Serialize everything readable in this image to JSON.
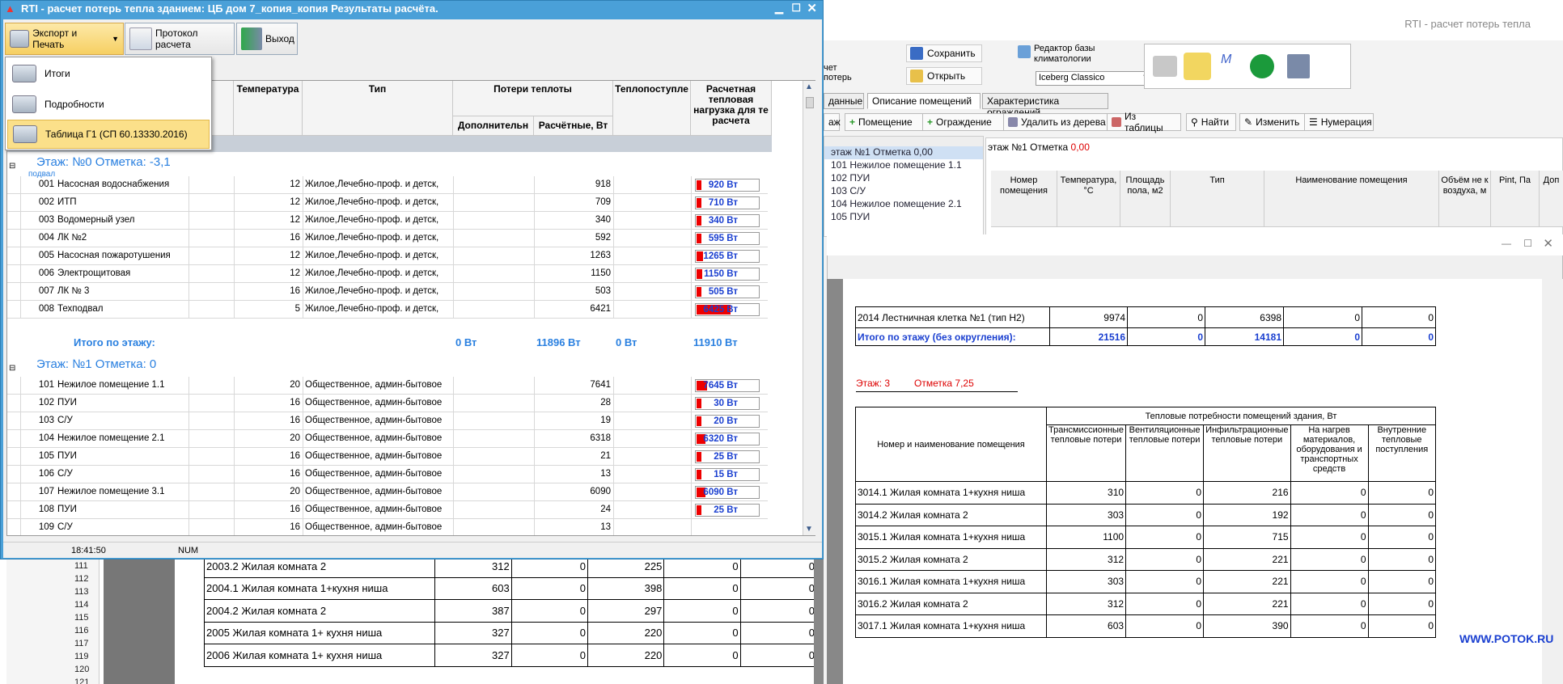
{
  "dialog": {
    "title": "RTI - расчет потерь тепла зданием: ЦБ дом 7_копия_копия Результаты расчёта.",
    "toolbar": {
      "export": "Экспорт и Печать",
      "protocol": "Протокол расчета",
      "exit": "Выход"
    },
    "menu": [
      {
        "label": "Итоги"
      },
      {
        "label": "Подробности"
      },
      {
        "label": "Таблица Г1 (СП 60.13330.2016)"
      }
    ],
    "headers": {
      "temp": "Температура",
      "type": "Тип",
      "losses": "Потери теплоты",
      "additional": "Дополнительн",
      "calculated": "Расчётные, Вт",
      "gains": "Теплопоступле",
      "load": "Расчетная тепловая нагрузка для те расчета"
    },
    "floor0": {
      "title": "Этаж:  №0 Отметка: -3,1",
      "sub": "подвал"
    },
    "floor1": {
      "title": "Этаж:  №1 Отметка: 0"
    },
    "rows0": [
      {
        "n": "001",
        "name": "Насосная водоснабжения",
        "t": "12",
        "type": "Жилое,Лечебно-проф. и детск,",
        "calc": "918",
        "load": "920 Вт",
        "f": 0.08
      },
      {
        "n": "002",
        "name": "ИТП",
        "t": "12",
        "type": "Жилое,Лечебно-проф. и детск,",
        "calc": "709",
        "load": "710 Вт",
        "f": 0.07
      },
      {
        "n": "003",
        "name": "Водомерный узел",
        "t": "12",
        "type": "Жилое,Лечебно-проф. и детск,",
        "calc": "340",
        "load": "340 Вт",
        "f": 0.05
      },
      {
        "n": "004",
        "name": "ЛК №2",
        "t": "16",
        "type": "Жилое,Лечебно-проф. и детск,",
        "calc": "592",
        "load": "595 Вт",
        "f": 0.06
      },
      {
        "n": "005",
        "name": "Насосная пожаротушения",
        "t": "12",
        "type": "Жилое,Лечебно-проф. и детск,",
        "calc": "1263",
        "load": "1265 Вт",
        "f": 0.1
      },
      {
        "n": "006",
        "name": "Электрощитовая",
        "t": "12",
        "type": "Жилое,Лечебно-проф. и детск,",
        "calc": "1150",
        "load": "1150 Вт",
        "f": 0.09
      },
      {
        "n": "007",
        "name": "ЛК № 3",
        "t": "16",
        "type": "Жилое,Лечебно-проф. и детск,",
        "calc": "503",
        "load": "505 Вт",
        "f": 0.06
      },
      {
        "n": "008",
        "name": "Техподвал",
        "t": "5",
        "type": "Жилое,Лечебно-проф. и детск,",
        "calc": "6421",
        "load": "6425 Вт",
        "f": 0.55
      }
    ],
    "total0": {
      "label": "Итого по этажу:",
      "add": "0 Вт",
      "calc": "11896 Вт",
      "gains": "0 Вт",
      "load": "11910 Вт"
    },
    "rows1": [
      {
        "n": "101",
        "name": "Нежилое помещение 1.1",
        "t": "20",
        "type": "Общественное, админ-бытовое",
        "calc": "7641",
        "load": "7645 Вт",
        "f": 0.17
      },
      {
        "n": "102",
        "name": "ПУИ",
        "t": "16",
        "type": "Общественное, админ-бытовое",
        "calc": "28",
        "load": "30 Вт",
        "f": 0
      },
      {
        "n": "103",
        "name": "С/У",
        "t": "16",
        "type": "Общественное, админ-бытовое",
        "calc": "19",
        "load": "20 Вт",
        "f": 0
      },
      {
        "n": "104",
        "name": "Нежилое помещение 2.1",
        "t": "20",
        "type": "Общественное, админ-бытовое",
        "calc": "6318",
        "load": "6320 Вт",
        "f": 0.14
      },
      {
        "n": "105",
        "name": "ПУИ",
        "t": "16",
        "type": "Общественное, админ-бытовое",
        "calc": "21",
        "load": "25 Вт",
        "f": 0
      },
      {
        "n": "106",
        "name": "С/У",
        "t": "16",
        "type": "Общественное, админ-бытовое",
        "calc": "13",
        "load": "15 Вт",
        "f": 0
      },
      {
        "n": "107",
        "name": "Нежилое помещение 3.1",
        "t": "20",
        "type": "Общественное, админ-бытовое",
        "calc": "6090",
        "load": "6090 Вт",
        "f": 0.14
      },
      {
        "n": "108",
        "name": "ПУИ",
        "t": "16",
        "type": "Общественное, админ-бытовое",
        "calc": "24",
        "load": "25 Вт",
        "f": 0
      },
      {
        "n": "109",
        "name": "С/У",
        "t": "16",
        "type": "Общественное, админ-бытовое",
        "calc": "13",
        "load": "",
        "f": 0
      }
    ],
    "status": {
      "time": "18:41:50",
      "num": "NUM"
    }
  },
  "bg": {
    "title": "RTI - расчет потерь тепла",
    "ribbon": {
      "save": "Сохранить",
      "open": "Открыть",
      "climate": "Редактор базы климатологии",
      "theme": "Iceberg Classico",
      "calc1": "чет",
      "calc2": "потерь"
    },
    "tabs": [
      "данные",
      "Описание помещений",
      "Характеристика ограждений"
    ],
    "tools": [
      "аж",
      "Помещение",
      "Ограждение",
      "Удалить из дерева",
      "Из таблицы",
      "Найти",
      "Изменить",
      "Нумерация"
    ],
    "floorlabel": "этаж №1 Отметка",
    "floorval": "0,00",
    "tree": [
      "этаж №1 Отметка  0,00",
      "101 Нежилое помещение 1.1",
      "102 ПУИ",
      "103 С/У",
      "104 Нежилое помещение 2.1",
      "105 ПУИ"
    ],
    "gridh": [
      "Номер помещения",
      "Температура, °C",
      "Площадь пола, м2",
      "Тип",
      "Наименование помещения",
      "Объём не к воздуха, м",
      "Pint, Па",
      "Доп"
    ]
  },
  "report": {
    "r2014": [
      "2014 Лестничная клетка №1 (тип Н2)",
      "9974",
      "0",
      "6398",
      "0",
      "0"
    ],
    "tot": [
      "Итого по этажу (без округления):",
      "21516",
      "0",
      "14181",
      "0",
      "0"
    ],
    "floor": "Этаж: 3",
    "mark": "Отметка 7,25",
    "h": {
      "name": "Номер и наименование помещения",
      "needs": "Тепловые потребности помещений здания, Вт",
      "c1": "Трансмиссионные тепловые потери",
      "c2": "Вентиляционные тепловые потери",
      "c3": "Инфильтрационные тепловые потери",
      "c4": "На нагрев материалов, оборудования и транспортных средств",
      "c5": "Внутренние тепловые поступления"
    },
    "rows": [
      [
        "3014.1 Жилая комната 1+кухня ниша",
        "310",
        "0",
        "216",
        "0",
        "0"
      ],
      [
        "3014.2 Жилая комната 2",
        "303",
        "0",
        "192",
        "0",
        "0"
      ],
      [
        "3015.1 Жилая комната 1+кухня ниша",
        "1100",
        "0",
        "715",
        "0",
        "0"
      ],
      [
        "3015.2 Жилая комната 2",
        "312",
        "0",
        "221",
        "0",
        "0"
      ],
      [
        "3016.1 Жилая комната 1+кухня ниша",
        "303",
        "0",
        "221",
        "0",
        "0"
      ],
      [
        "3016.2 Жилая комната 2",
        "312",
        "0",
        "221",
        "0",
        "0"
      ],
      [
        "3017.1 Жилая комната 1+кухня ниша",
        "603",
        "0",
        "390",
        "0",
        "0"
      ]
    ],
    "watermark": "WWW.POTOK.RU"
  },
  "low": {
    "tree": [
      "111",
      "112",
      "113",
      "114",
      "115",
      "116",
      "117",
      "119",
      "120",
      "121"
    ],
    "rows": [
      [
        "2003.2 Жилая комната 2",
        "312",
        "0",
        "225",
        "0",
        "0"
      ],
      [
        "2004.1 Жилая комната 1+кухня ниша",
        "603",
        "0",
        "398",
        "0",
        "0"
      ],
      [
        "2004.2 Жилая комната 2",
        "387",
        "0",
        "297",
        "0",
        "0"
      ],
      [
        "2005 Жилая комната 1+ кухня ниша",
        "327",
        "0",
        "220",
        "0",
        "0"
      ],
      [
        "2006 Жилая комната 1+ кухня ниша",
        "327",
        "0",
        "220",
        "0",
        "0"
      ]
    ]
  }
}
